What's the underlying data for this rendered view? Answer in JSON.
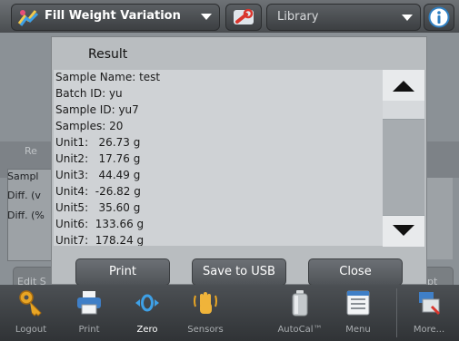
{
  "header": {
    "app_title": "Fill Weight Variation",
    "library_label": "Library"
  },
  "background": {
    "left_tab_text": "Re",
    "row1_text": "Sampl",
    "row2_text": "Diff. (v",
    "row3_text": "Diff. (%",
    "edit_button_text": "Edit S",
    "right_button_text": "pt"
  },
  "dialog": {
    "title": "Result",
    "lines": [
      "Sample Name: test",
      "Batch ID: yu",
      "Sample ID: yu7",
      "Samples: 20",
      "Unit1:   26.73 g",
      "Unit2:   17.76 g",
      "Unit3:   44.49 g",
      "Unit4:  -26.82 g",
      "Unit5:   35.60 g",
      "Unit6:  133.66 g",
      "Unit7:  178.24 g"
    ],
    "buttons": {
      "print": "Print",
      "save_usb": "Save to USB",
      "close": "Close"
    }
  },
  "toolbar": {
    "items": [
      {
        "label": "Logout",
        "icon": "key-icon"
      },
      {
        "label": "Print",
        "icon": "printer-icon"
      },
      {
        "label": "Zero",
        "icon": "zero-icon"
      },
      {
        "label": "Sensors",
        "icon": "hand-sensor-icon"
      },
      {
        "label": "AutoCal™",
        "icon": "calibration-weight-icon"
      },
      {
        "label": "Menu",
        "icon": "menu-list-icon"
      },
      {
        "label": "More...",
        "icon": "more-tools-icon"
      }
    ]
  },
  "colors": {
    "accent_orange": "#e8a524",
    "accent_blue": "#2e8fd6",
    "dialog_bg": "#b9bdc0",
    "content_bg": "#cfd2d5"
  }
}
